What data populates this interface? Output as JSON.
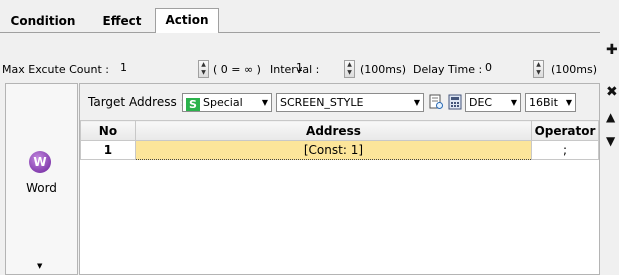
{
  "tabs": [
    {
      "label": "Condition",
      "active": false
    },
    {
      "label": "Effect",
      "active": false
    },
    {
      "label": "Action",
      "active": true
    }
  ],
  "settings": {
    "max_execute_label": "Max Excute Count :",
    "max_execute_value": "1",
    "infinite_hint": "( 0 = ∞ )",
    "interval_label": "Interval :",
    "interval_value": "1",
    "interval_unit": "(100ms)",
    "delay_label": "Delay Time :",
    "delay_value": "0",
    "delay_unit": "(100ms)"
  },
  "left_panel": {
    "icon_letter": "W",
    "label": "Word"
  },
  "toolbar": {
    "target_label": "Target Address :",
    "special_badge": "S",
    "special_value": "Special",
    "address_value": "SCREEN_STYLE",
    "format_value": "DEC",
    "size_value": "16Bit"
  },
  "table": {
    "headers": [
      "No",
      "Address",
      "Operator"
    ],
    "rows": [
      {
        "no": "1",
        "address": "[Const: 1]",
        "operator": ";"
      }
    ]
  },
  "side_buttons": [
    "add-icon",
    "delete-icon",
    "move-up-icon",
    "move-down-icon"
  ],
  "colors": {
    "selected_cell": "#fce59a",
    "word_icon": "#8a3bb5",
    "special_badge": "#2bb24c"
  }
}
